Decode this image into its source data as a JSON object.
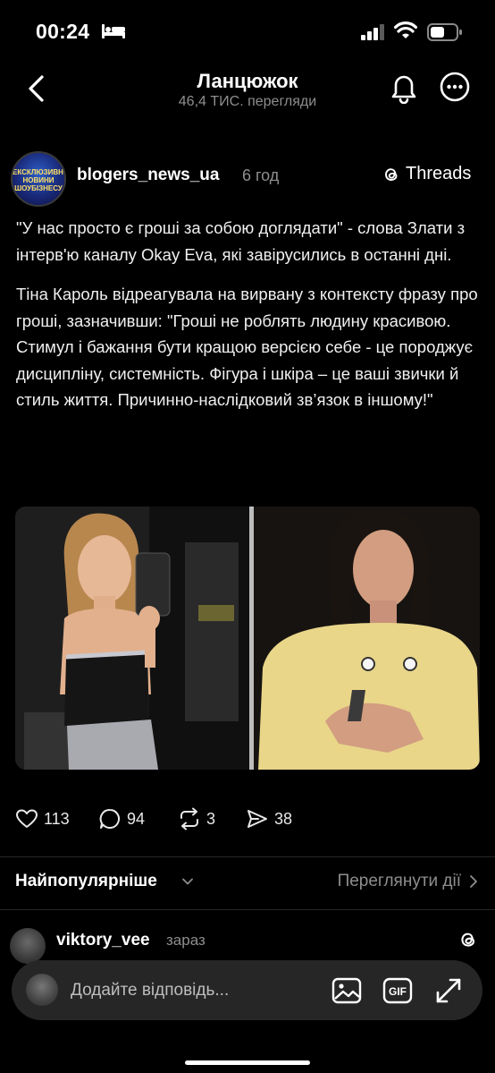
{
  "status_bar": {
    "time": "00:24",
    "icons": [
      "bed-icon",
      "signal-icon",
      "wifi-icon",
      "battery-icon"
    ]
  },
  "nav": {
    "title": "Ланцюжок",
    "subtitle": "46,4 ТИС. перегляди",
    "icons": [
      "back-icon",
      "bell-icon",
      "more-icon"
    ]
  },
  "post": {
    "avatar_text": "ЕКСКЛЮЗИВНІ НОВИНИ ШОУБІЗНЕСУ",
    "username": "blogers_news_ua",
    "time": "6 год",
    "source_label": "Threads",
    "paragraphs": [
      "\"У нас просто є гроші за собою доглядати\" - слова Злати з інтерв'ю каналу Okay Eva, які завірусились в останні дні.",
      "Тіна Кароль відреагувала на вирвану з контексту фразу про гроші, зазначивши: \"Гроші не роблять людину красивою. Стимул і бажання бути кращою версією себе - це породжує дисципліну, системність. Фігура і шкіра – це ваші звички й стиль життя. Причинно-наслідковий зв’язок в іншому!\""
    ],
    "likes": "113",
    "comments": "94",
    "reposts": "3",
    "shares": "38"
  },
  "sort": {
    "label": "Найпопулярніше",
    "activity_link": "Переглянути дії"
  },
  "reply": {
    "username": "viktory_vee",
    "time": "зараз"
  },
  "composer": {
    "placeholder": "Додайте відповідь...",
    "gif_label": "GIF"
  },
  "colors": {
    "background": "#000000",
    "text": "#f5f5f5",
    "muted": "#8e8e8e",
    "composer_bg": "#262626"
  }
}
